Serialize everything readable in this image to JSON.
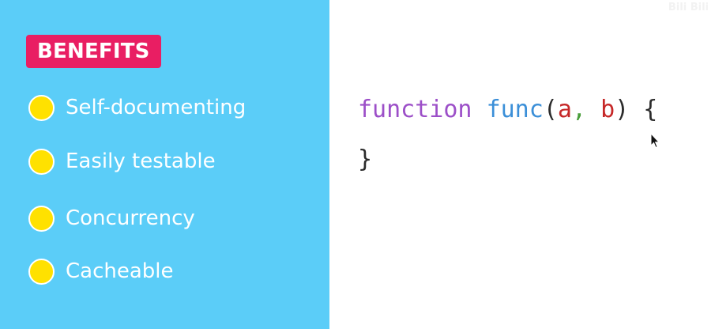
{
  "colors": {
    "panel_background": "#5bcdf8",
    "badge_background": "#e91e63",
    "bullet_fill": "#ffe100",
    "code_keyword": "#9c4fc8",
    "code_function": "#3b8fd8",
    "code_param": "#c62828",
    "code_punct": "#2b2b2b",
    "code_comma": "#4a9e3b"
  },
  "benefits": {
    "badge_label": "BENEFITS",
    "items": [
      {
        "label": "Self-documenting",
        "icon": "yellow-dot-icon"
      },
      {
        "label": "Easily testable",
        "icon": "yellow-dot-icon"
      },
      {
        "label": "Concurrency",
        "icon": "yellow-dot-icon"
      },
      {
        "label": "Cacheable",
        "icon": "yellow-dot-icon"
      }
    ]
  },
  "code": {
    "line1": {
      "keyword": "function",
      "name": "func",
      "open_paren": "(",
      "param_a": "a",
      "comma": ",",
      "param_b": "b",
      "close_paren": ")",
      "open_brace": "{"
    },
    "line2": {
      "close_brace": "}"
    }
  },
  "watermark": "Bili Bili",
  "cursor": {
    "icon": "mouse-pointer-icon"
  }
}
